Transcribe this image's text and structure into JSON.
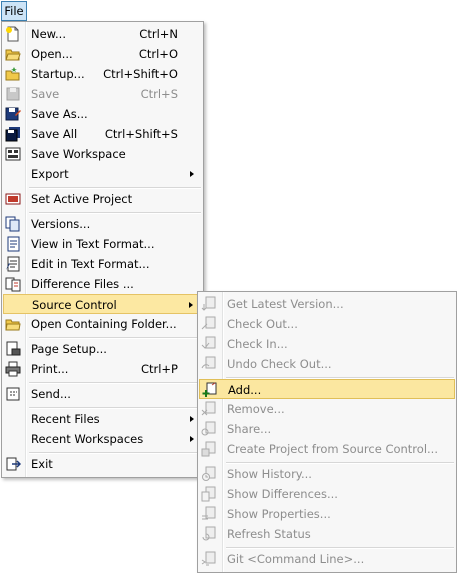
{
  "menubar": {
    "file_label": "File"
  },
  "file_menu": {
    "items": [
      {
        "label": "New...",
        "shortcut": "Ctrl+N"
      },
      {
        "label": "Open...",
        "shortcut": "Ctrl+O"
      },
      {
        "label": "Startup...",
        "shortcut": "Ctrl+Shift+O"
      },
      {
        "label": "Save",
        "shortcut": "Ctrl+S",
        "disabled": true
      },
      {
        "label": "Save As...",
        "shortcut": ""
      },
      {
        "label": "Save All",
        "shortcut": "Ctrl+Shift+S"
      },
      {
        "label": "Save Workspace",
        "shortcut": ""
      },
      {
        "label": "Export",
        "shortcut": "",
        "submenu": true
      },
      {
        "label": "Set Active Project",
        "shortcut": ""
      },
      {
        "label": "Versions...",
        "shortcut": ""
      },
      {
        "label": "View in Text Format...",
        "shortcut": ""
      },
      {
        "label": "Edit in Text Format...",
        "shortcut": ""
      },
      {
        "label": "Difference Files ...",
        "shortcut": ""
      },
      {
        "label": "Source Control",
        "shortcut": "",
        "submenu": true,
        "highlighted": true
      },
      {
        "label": "Open Containing Folder...",
        "shortcut": ""
      },
      {
        "label": "Page Setup...",
        "shortcut": ""
      },
      {
        "label": "Print...",
        "shortcut": "Ctrl+P"
      },
      {
        "label": "Send...",
        "shortcut": ""
      },
      {
        "label": "Recent Files",
        "shortcut": "",
        "submenu": true
      },
      {
        "label": "Recent Workspaces",
        "shortcut": "",
        "submenu": true
      },
      {
        "label": "Exit",
        "shortcut": ""
      }
    ]
  },
  "source_control_menu": {
    "items": [
      {
        "label": "Get Latest Version...",
        "disabled": true
      },
      {
        "label": "Check Out...",
        "disabled": true
      },
      {
        "label": "Check In...",
        "disabled": true
      },
      {
        "label": "Undo Check Out...",
        "disabled": true
      },
      {
        "label": "Add...",
        "disabled": false,
        "highlighted": true
      },
      {
        "label": "Remove...",
        "disabled": true
      },
      {
        "label": "Share...",
        "disabled": true
      },
      {
        "label": "Create Project from Source Control...",
        "disabled": true
      },
      {
        "label": "Show History...",
        "disabled": true
      },
      {
        "label": "Show Differences...",
        "disabled": true
      },
      {
        "label": "Show Properties...",
        "disabled": true
      },
      {
        "label": "Refresh Status",
        "disabled": true
      },
      {
        "label": "Git <Command Line>...",
        "disabled": true
      }
    ]
  },
  "colors": {
    "highlight_bg": "#fce8a2",
    "highlight_border": "#e5c365",
    "menu_bg": "#f7f7f7",
    "disabled_text": "#8d8d8d"
  }
}
